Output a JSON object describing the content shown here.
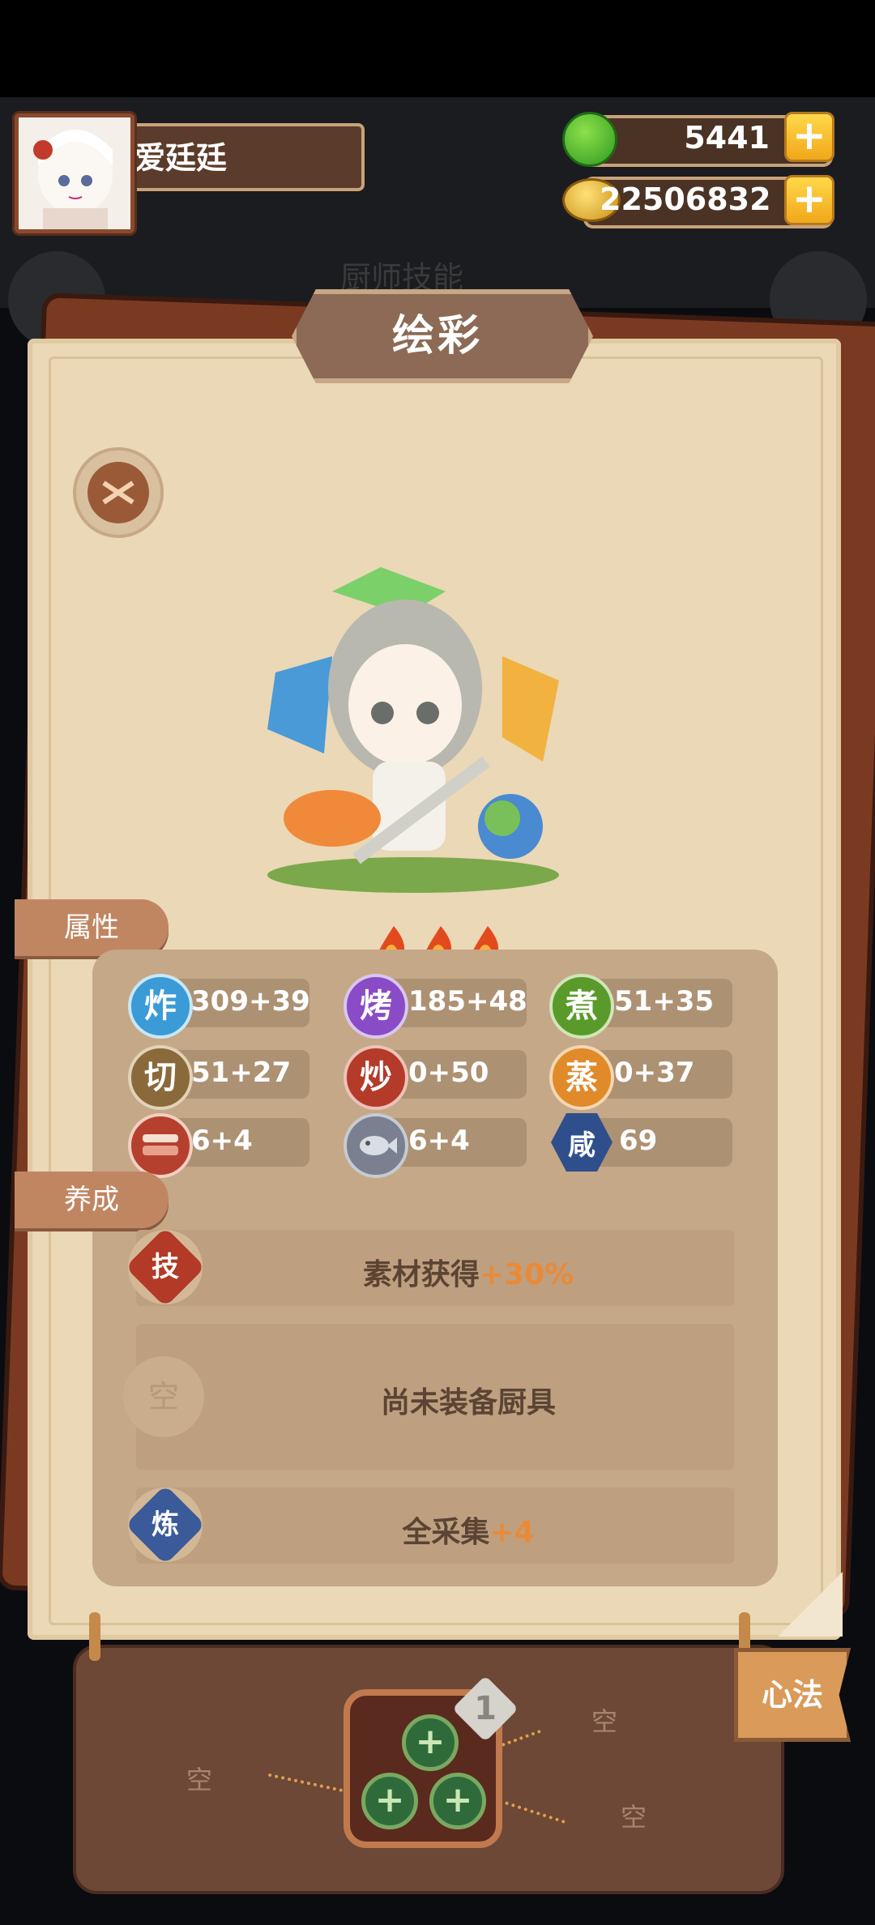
{
  "player": {
    "name": "爱廷廷"
  },
  "resources": {
    "jade": "5441",
    "coins": "22506832"
  },
  "page": {
    "title": "绘彩"
  },
  "sections": {
    "attributes": "属性",
    "cultivation": "养成"
  },
  "stats": [
    {
      "glyph": "炸",
      "value": "309+39",
      "color": "#3a9bd6"
    },
    {
      "glyph": "烤",
      "value": "185+48",
      "color": "#8a4bc6"
    },
    {
      "glyph": "煮",
      "value": "51+35",
      "color": "#5a9a2a"
    },
    {
      "glyph": "切",
      "value": "51+27",
      "color": "#8a6a3a"
    },
    {
      "glyph": "炒",
      "value": "0+50",
      "color": "#b43a2a"
    },
    {
      "glyph": "蒸",
      "value": "0+37",
      "color": "#e08a2a"
    },
    {
      "glyph": "",
      "value": "6+4",
      "color": "#b6402e"
    },
    {
      "glyph": "",
      "value": "6+4",
      "color": "#7a8090"
    },
    {
      "glyph": "咸",
      "value": "69",
      "color": "#2f4f8c"
    }
  ],
  "cultivation": {
    "skill": {
      "badge": "技",
      "text": "素材获得",
      "bonus": "+30%"
    },
    "equip": {
      "badge": "空",
      "text": "尚未装备厨具"
    },
    "refine": {
      "badge": "炼",
      "text": "全采集",
      "bonus": "+4"
    }
  },
  "bottom": {
    "slot_badge": "1",
    "empty_labels": [
      "空",
      "空",
      "空"
    ],
    "xinfa": "心法"
  },
  "watermark": "厨师技能"
}
